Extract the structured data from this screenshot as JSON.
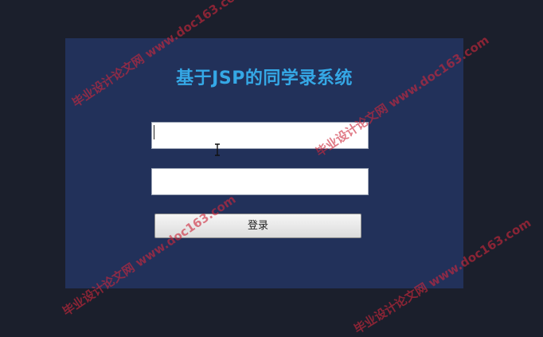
{
  "login": {
    "title": "基于JSP的同学录系统",
    "username": {
      "value": "",
      "placeholder": ""
    },
    "password": {
      "value": "",
      "placeholder": ""
    },
    "submit_label": "登录"
  },
  "watermarks": [
    "毕业设计论文网 www.doc163.com",
    "毕业设计论文网 www.doc163.com",
    "毕业设计论文网 www.doc163.com",
    "毕业设计论文网 www.doc163.com"
  ],
  "colors": {
    "page_bg": "#1b1f2c",
    "panel_bg": "#22315a",
    "title": "#35a8e6",
    "watermark": "#cd283c"
  },
  "icons": [
    "text-cursor-icon"
  ]
}
